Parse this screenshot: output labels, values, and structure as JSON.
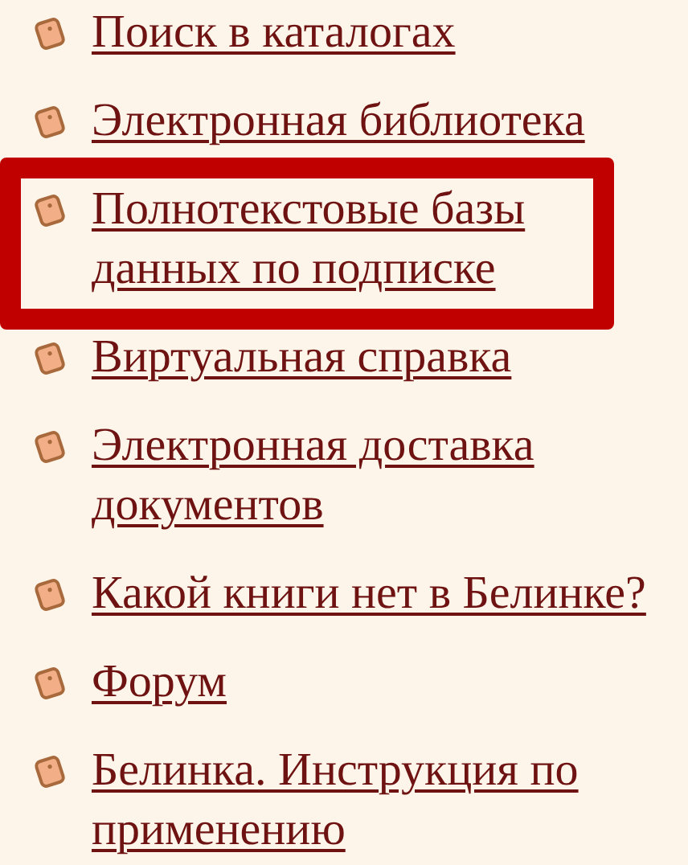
{
  "links": [
    {
      "label": "Поиск в каталогах",
      "highlighted": false
    },
    {
      "label": "Электронная библиотека",
      "highlighted": false
    },
    {
      "label": "Полнотекстовые базы данных по подписке",
      "highlighted": true
    },
    {
      "label": "Виртуальная справка",
      "highlighted": false
    },
    {
      "label": "Электронная доставка документов",
      "highlighted": false
    },
    {
      "label": "Какой книги нет в Белинке?",
      "highlighted": false
    },
    {
      "label": "Форум",
      "highlighted": false
    },
    {
      "label": "Белинка. Инструкция по применению",
      "highlighted": false
    }
  ]
}
